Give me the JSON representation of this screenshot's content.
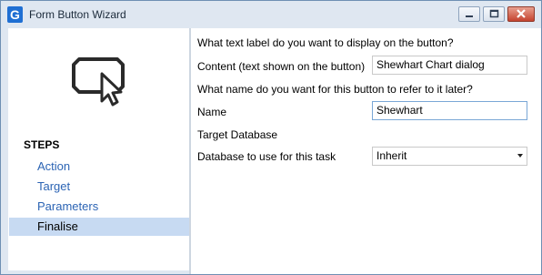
{
  "window": {
    "title": "Form Button Wizard",
    "app_icon_letter": "G"
  },
  "sidebar": {
    "steps_heading": "STEPS",
    "steps": [
      {
        "label": "Action",
        "active": false
      },
      {
        "label": "Target",
        "active": false
      },
      {
        "label": "Parameters",
        "active": false
      },
      {
        "label": "Finalise",
        "active": true
      }
    ]
  },
  "form": {
    "label_question": "What text label do you want to display on the button?",
    "content_label": "Content (text shown on the button)",
    "content_value": "Shewhart Chart dialog",
    "name_question": "What name do you want for this button to refer to it later?",
    "name_label": "Name",
    "name_value": "Shewhart",
    "target_db_heading": "Target Database",
    "db_label": "Database to use for this task",
    "db_value": "Inherit"
  },
  "colors": {
    "accent": "#1f6fd3",
    "step_link": "#2c64b4",
    "step_active_bg": "#c7daf2"
  }
}
